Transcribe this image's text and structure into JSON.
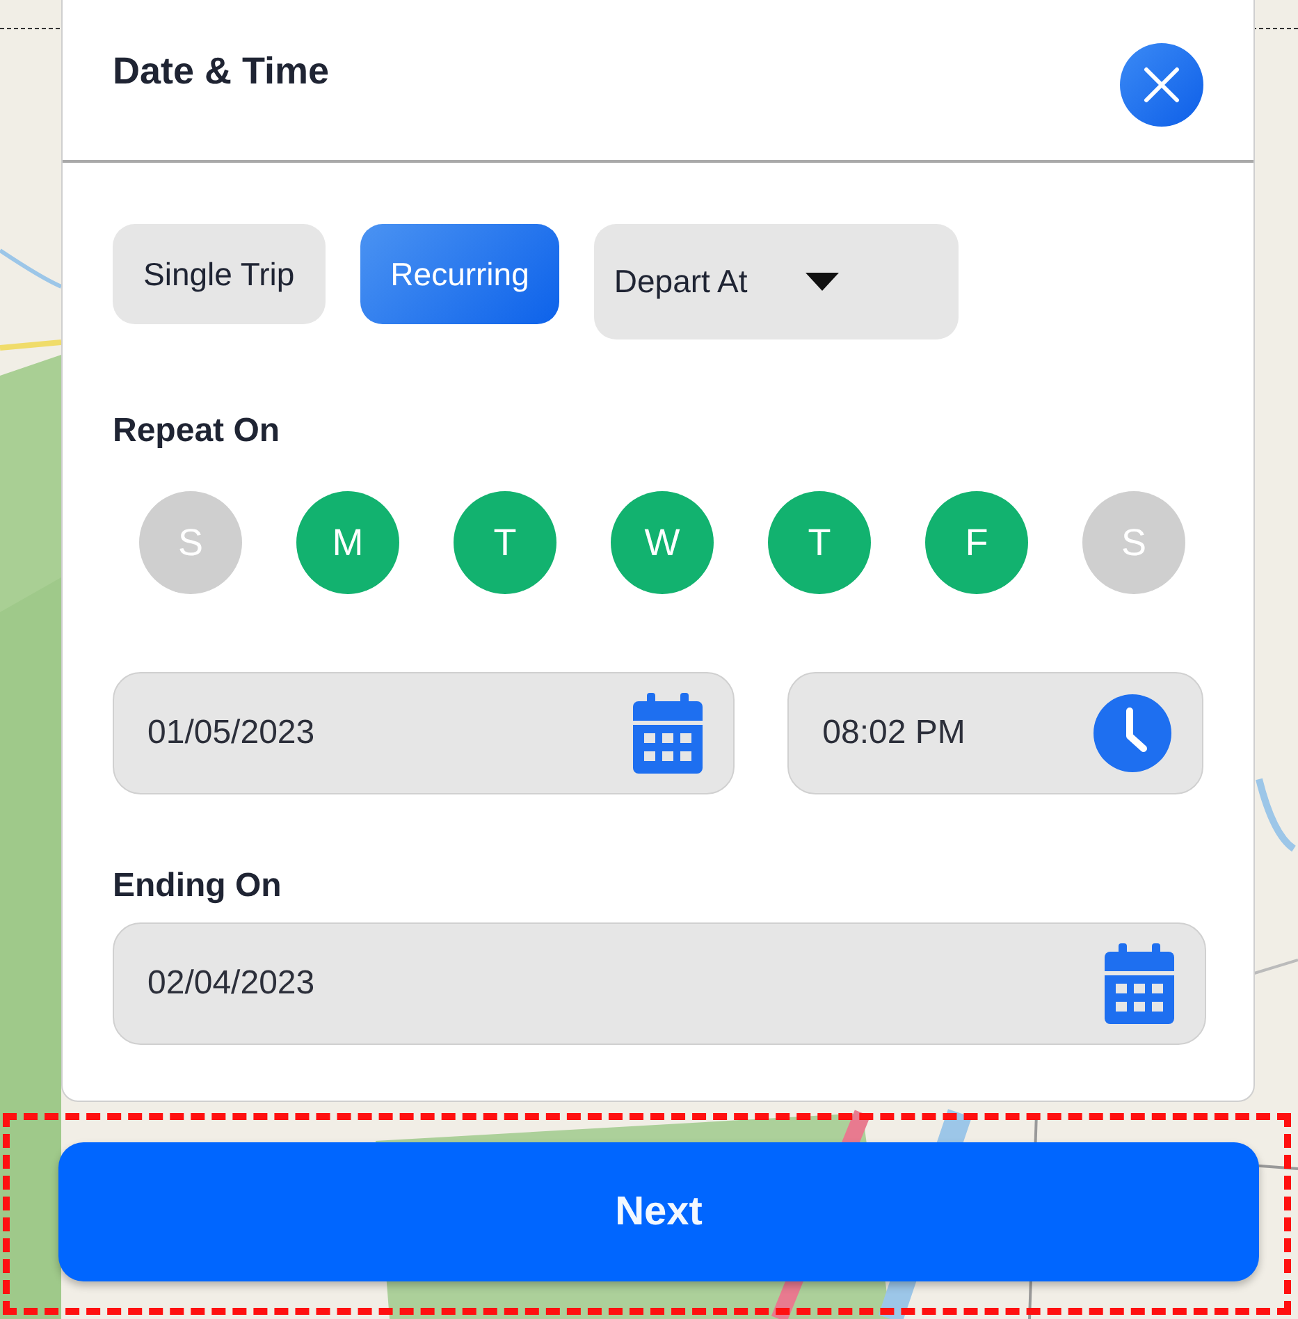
{
  "dialog": {
    "title": "Date & Time"
  },
  "trip_types": [
    {
      "label": "Single Trip",
      "selected": false
    },
    {
      "label": "Recurring",
      "selected": true
    }
  ],
  "timing_dropdown": {
    "value": "Depart At"
  },
  "repeat_on": {
    "label": "Repeat On",
    "days": [
      {
        "letter": "S",
        "selected": false
      },
      {
        "letter": "M",
        "selected": true
      },
      {
        "letter": "T",
        "selected": true
      },
      {
        "letter": "W",
        "selected": true
      },
      {
        "letter": "T",
        "selected": true
      },
      {
        "letter": "F",
        "selected": true
      },
      {
        "letter": "S",
        "selected": false
      }
    ]
  },
  "start": {
    "date": "01/05/2023",
    "time": "08:02 PM"
  },
  "ending_on": {
    "label": "Ending On",
    "date": "02/04/2023"
  },
  "next_button": {
    "label": "Next"
  }
}
